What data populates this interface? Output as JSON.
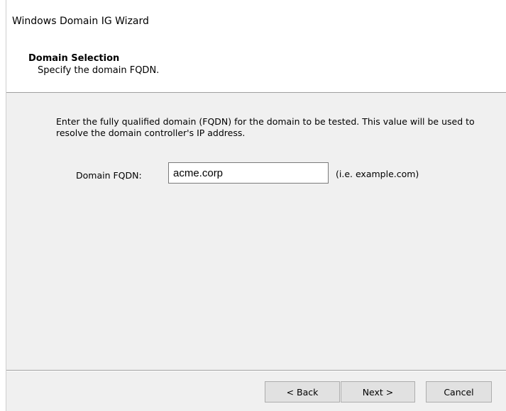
{
  "window": {
    "title": "Windows Domain IG Wizard"
  },
  "header": {
    "title": "Domain Selection",
    "subtitle": "Specify the domain FQDN."
  },
  "main": {
    "description": "Enter the fully qualified domain (FQDN) for the domain to be tested. This value will be used to resolve the domain controller's IP address.",
    "field_label": "Domain FQDN:",
    "field_value": "acme.corp",
    "field_hint": "(i.e. example.com)"
  },
  "footer": {
    "back_label": "< Back",
    "next_label": "Next >",
    "cancel_label": "Cancel"
  }
}
